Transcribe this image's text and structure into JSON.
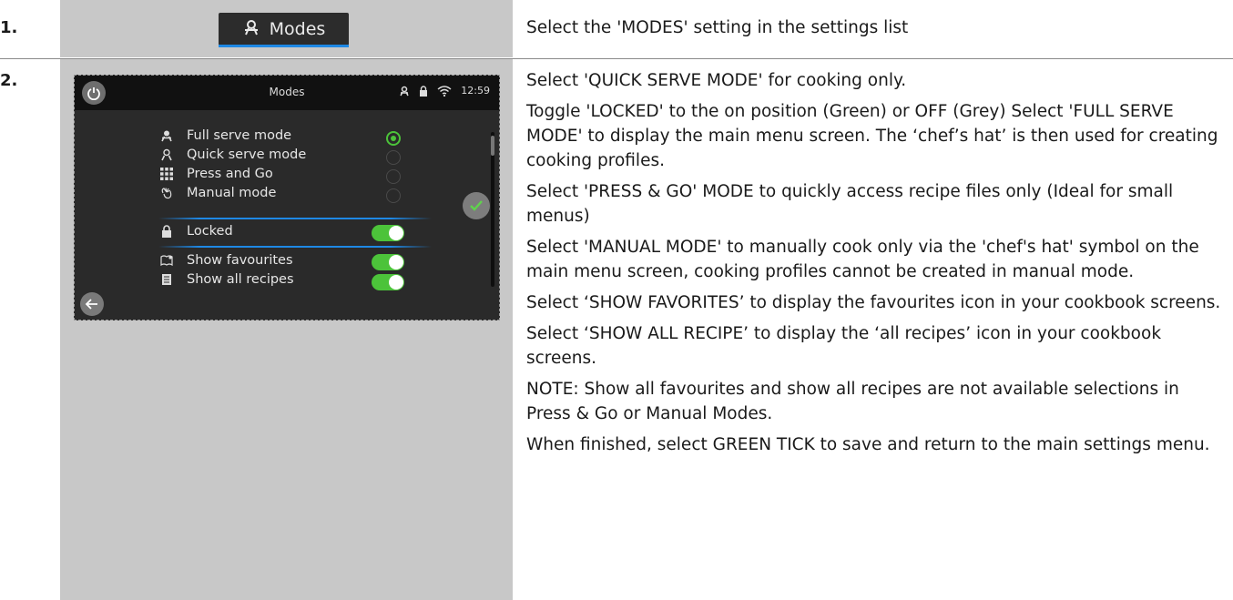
{
  "steps": [
    {
      "number": "1.",
      "button_label": "Modes",
      "instruction": "Select the 'MODES' setting in the settings list"
    },
    {
      "number": "2."
    }
  ],
  "screen": {
    "title": "Modes",
    "time": "12:59",
    "modes": [
      {
        "label": "Full serve mode",
        "icon": "chef-hat-icon",
        "selected": true
      },
      {
        "label": "Quick serve mode",
        "icon": "chef-hat-outline-icon",
        "selected": false
      },
      {
        "label": "Press and Go",
        "icon": "grid-icon",
        "selected": false
      },
      {
        "label": "Manual mode",
        "icon": "hand-icon",
        "selected": false
      }
    ],
    "locked": {
      "label": "Locked",
      "on": true
    },
    "options": [
      {
        "label": "Show favourites",
        "icon": "book-star-icon",
        "on": true
      },
      {
        "label": "Show all recipes",
        "icon": "document-icon",
        "on": true
      }
    ],
    "colors": {
      "accent_blue": "#1e88e5",
      "toggle_green": "#4cc33a"
    }
  },
  "instructions": [
    "Select 'QUICK SERVE MODE' for cooking only.",
    "Toggle 'LOCKED' to the on position (Green) or OFF (Grey) Select 'FULL SERVE MODE' to display the main menu screen. The ‘chef’s hat’ is then used for creating cooking profiles.",
    "Select 'PRESS & GO' MODE to quickly access recipe files only (Ideal for small menus)",
    "Select 'MANUAL MODE' to manually cook only via the 'chef's hat' symbol on the main menu screen, cooking profiles cannot be created in manual mode.",
    "Select ‘SHOW FAVORITES’ to display the favourites icon in your cookbook screens.",
    "Select ‘SHOW ALL RECIPE’ to display the ‘all recipes’ icon in your cookbook screens.",
    "NOTE: Show all favourites and show all recipes are not available selections in Press & Go or Manual Modes.",
    "When finished, select GREEN TICK to save and return to the main settings menu."
  ]
}
